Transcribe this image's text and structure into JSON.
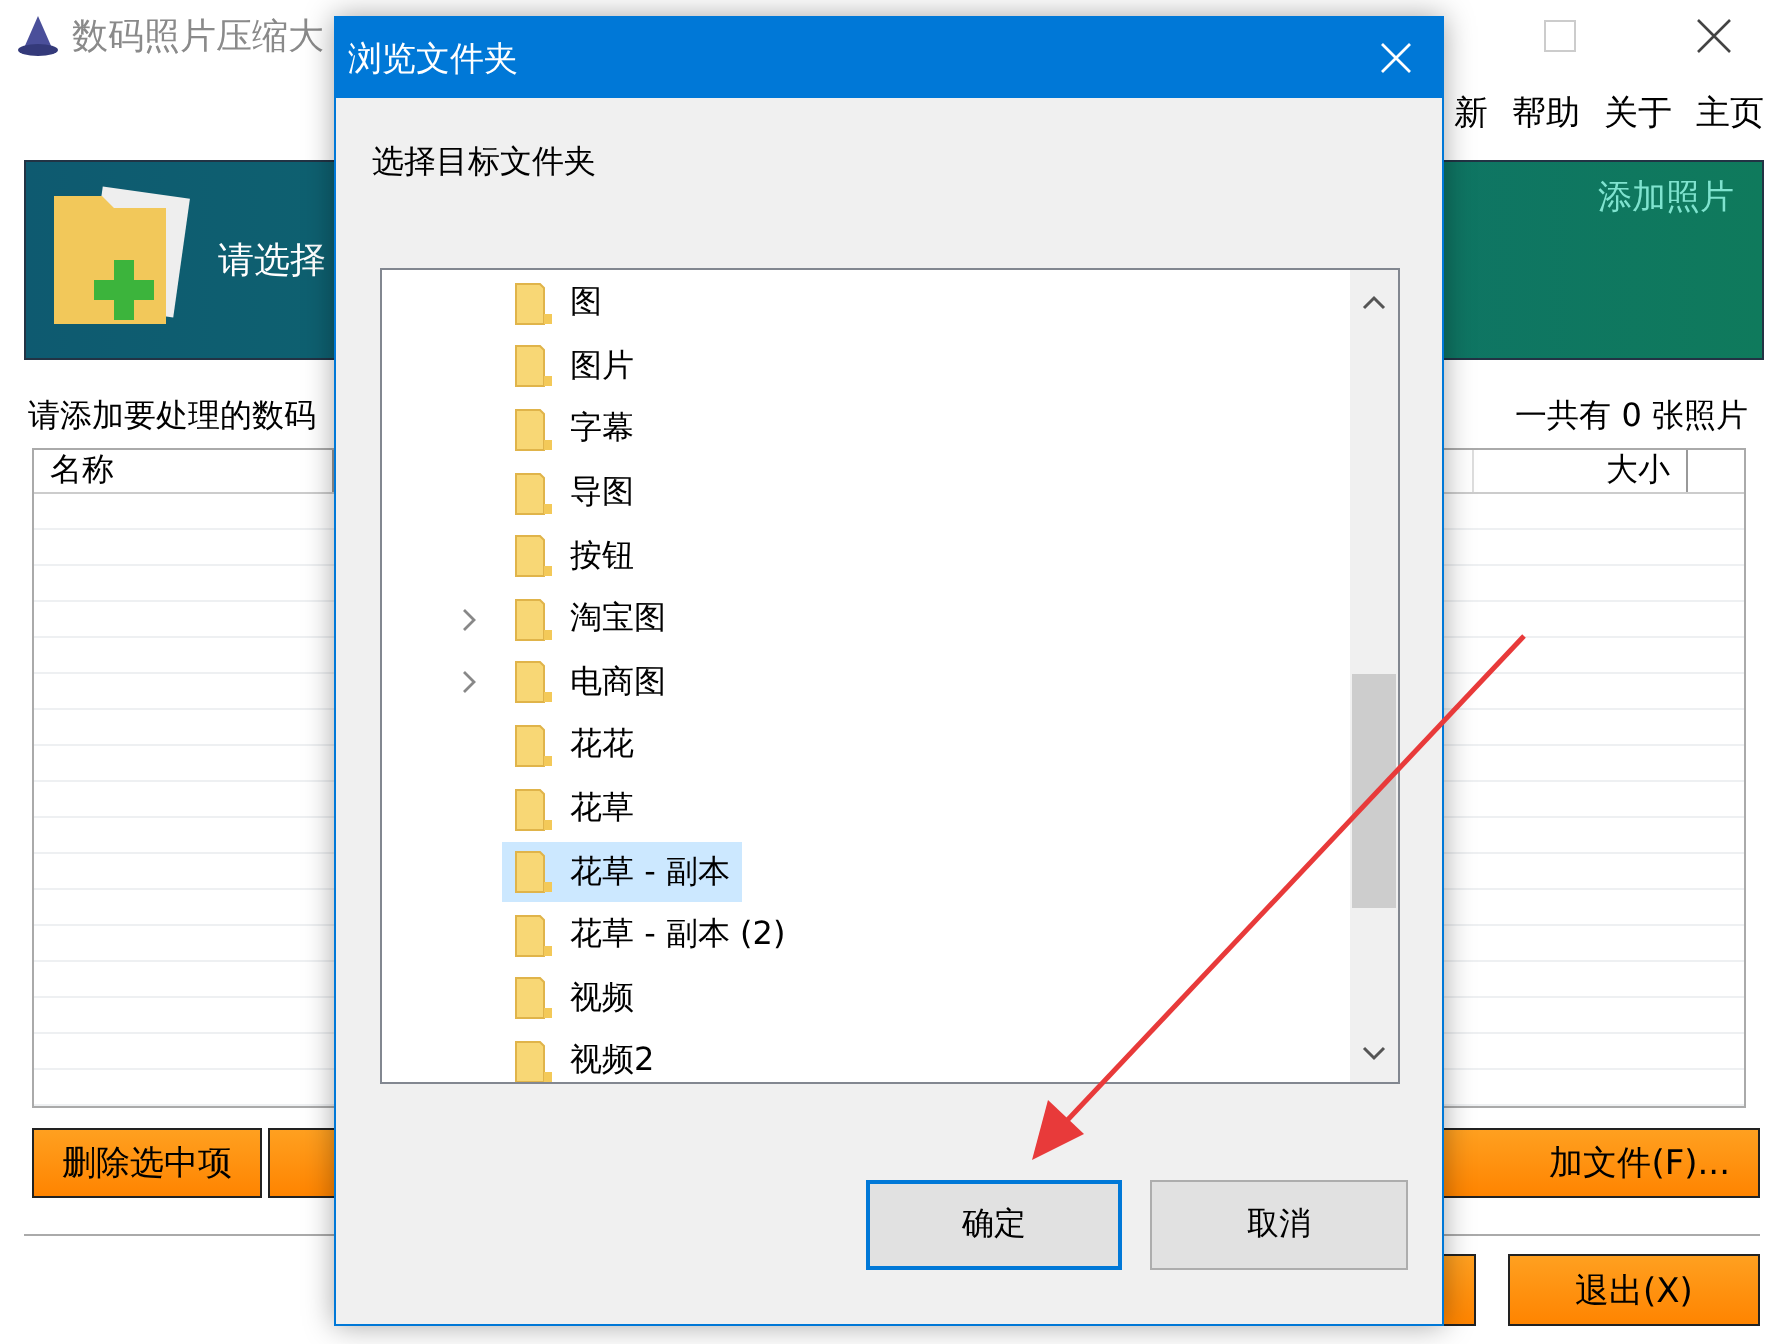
{
  "app": {
    "title": "数码照片压缩大",
    "menu": [
      "新",
      "帮助",
      "关于",
      "主页"
    ],
    "banner": {
      "prompt": "请选择",
      "action": "添加照片"
    },
    "hint": "请添加要处理的数码",
    "count": "一共有 0 张照片",
    "table": {
      "columns": [
        "名称",
        "大小"
      ]
    },
    "left_button": "删除选中项",
    "right_button": "加文件(F)...",
    "exit_button": "退出(X)"
  },
  "dialog": {
    "title": "浏览文件夹",
    "prompt": "选择目标文件夹",
    "folders": [
      {
        "name": "图",
        "expandable": false,
        "selected": false
      },
      {
        "name": "图片",
        "expandable": false,
        "selected": false
      },
      {
        "name": "字幕",
        "expandable": false,
        "selected": false
      },
      {
        "name": "导图",
        "expandable": false,
        "selected": false
      },
      {
        "name": "按钮",
        "expandable": false,
        "selected": false
      },
      {
        "name": "淘宝图",
        "expandable": true,
        "selected": false
      },
      {
        "name": "电商图",
        "expandable": true,
        "selected": false
      },
      {
        "name": "花花",
        "expandable": false,
        "selected": false
      },
      {
        "name": "花草",
        "expandable": false,
        "selected": false
      },
      {
        "name": "花草 - 副本",
        "expandable": false,
        "selected": true
      },
      {
        "name": "花草 - 副本 (2)",
        "expandable": false,
        "selected": false
      },
      {
        "name": "视频",
        "expandable": false,
        "selected": false
      },
      {
        "name": "视频2",
        "expandable": false,
        "selected": false
      }
    ],
    "buttons": [
      {
        "label": "确定",
        "default": true
      },
      {
        "label": "取消",
        "default": false
      }
    ]
  }
}
